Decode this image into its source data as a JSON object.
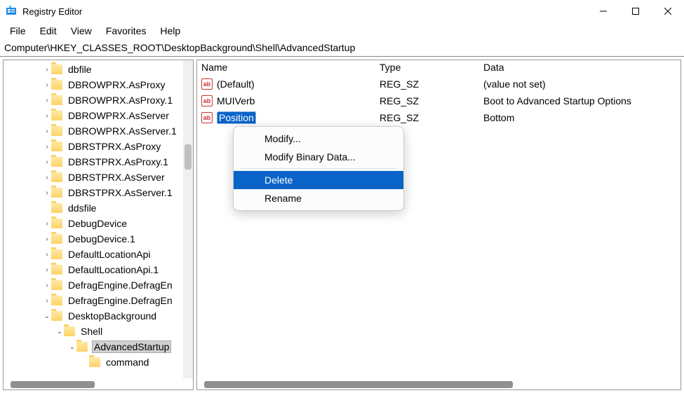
{
  "window": {
    "title": "Registry Editor"
  },
  "menubar": [
    "File",
    "Edit",
    "View",
    "Favorites",
    "Help"
  ],
  "address": "Computer\\HKEY_CLASSES_ROOT\\DesktopBackground\\Shell\\AdvancedStartup",
  "tree": [
    {
      "indent": 2,
      "chev": ">",
      "label": "dbfile"
    },
    {
      "indent": 2,
      "chev": ">",
      "label": "DBROWPRX.AsProxy"
    },
    {
      "indent": 2,
      "chev": ">",
      "label": "DBROWPRX.AsProxy.1"
    },
    {
      "indent": 2,
      "chev": ">",
      "label": "DBROWPRX.AsServer"
    },
    {
      "indent": 2,
      "chev": ">",
      "label": "DBROWPRX.AsServer.1"
    },
    {
      "indent": 2,
      "chev": ">",
      "label": "DBRSTPRX.AsProxy"
    },
    {
      "indent": 2,
      "chev": ">",
      "label": "DBRSTPRX.AsProxy.1"
    },
    {
      "indent": 2,
      "chev": ">",
      "label": "DBRSTPRX.AsServer"
    },
    {
      "indent": 2,
      "chev": ">",
      "label": "DBRSTPRX.AsServer.1"
    },
    {
      "indent": 2,
      "chev": "",
      "label": "ddsfile"
    },
    {
      "indent": 2,
      "chev": ">",
      "label": "DebugDevice"
    },
    {
      "indent": 2,
      "chev": ">",
      "label": "DebugDevice.1"
    },
    {
      "indent": 2,
      "chev": ">",
      "label": "DefaultLocationApi"
    },
    {
      "indent": 2,
      "chev": ">",
      "label": "DefaultLocationApi.1"
    },
    {
      "indent": 2,
      "chev": ">",
      "label": "DefragEngine.DefragEn"
    },
    {
      "indent": 2,
      "chev": ">",
      "label": "DefragEngine.DefragEn"
    },
    {
      "indent": 2,
      "chev": "v",
      "label": "DesktopBackground"
    },
    {
      "indent": 3,
      "chev": "v",
      "label": "Shell"
    },
    {
      "indent": 4,
      "chev": "v",
      "label": "AdvancedStartup",
      "selected": true
    },
    {
      "indent": 5,
      "chev": "",
      "label": "command"
    }
  ],
  "columns": {
    "name": "Name",
    "type": "Type",
    "data": "Data"
  },
  "values": [
    {
      "name": "(Default)",
      "type": "REG_SZ",
      "data": "(value not set)"
    },
    {
      "name": "MUIVerb",
      "type": "REG_SZ",
      "data": "Boot to Advanced Startup Options"
    },
    {
      "name": "Position",
      "type": "REG_SZ",
      "data": "Bottom",
      "selected": true
    }
  ],
  "context_menu": {
    "modify": "Modify...",
    "modify_binary": "Modify Binary Data...",
    "delete": "Delete",
    "rename": "Rename"
  },
  "icons": {
    "val": "ab"
  }
}
